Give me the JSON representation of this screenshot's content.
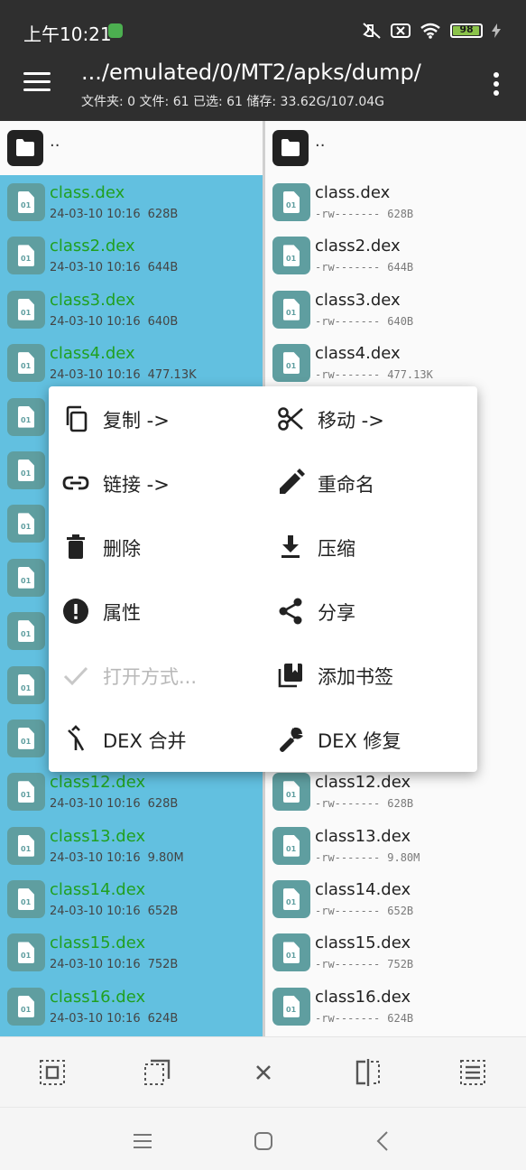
{
  "status_bar": {
    "time": "上午10:21",
    "battery": "98",
    "battery_level": 0.98
  },
  "header": {
    "path": ".../emulated/0/MT2/apks/dump/",
    "info": "文件夹: 0  文件: 61  已选: 61  储存: 33.62G/107.04G"
  },
  "parent_label": "..",
  "left_files": [
    {
      "name": "class.dex",
      "date": "24-03-10 10:16",
      "size": "628B"
    },
    {
      "name": "class2.dex",
      "date": "24-03-10 10:16",
      "size": "644B"
    },
    {
      "name": "class3.dex",
      "date": "24-03-10 10:16",
      "size": "640B"
    },
    {
      "name": "class4.dex",
      "date": "24-03-10 10:16",
      "size": "477.13K"
    },
    {
      "name": "",
      "date": "",
      "size": ""
    },
    {
      "name": "",
      "date": "",
      "size": ""
    },
    {
      "name": "",
      "date": "",
      "size": ""
    },
    {
      "name": "",
      "date": "",
      "size": ""
    },
    {
      "name": "",
      "date": "",
      "size": ""
    },
    {
      "name": "",
      "date": "",
      "size": ""
    },
    {
      "name": "",
      "date": "",
      "size": ""
    },
    {
      "name": "class12.dex",
      "date": "24-03-10 10:16",
      "size": "628B"
    },
    {
      "name": "class13.dex",
      "date": "24-03-10 10:16",
      "size": "9.80M"
    },
    {
      "name": "class14.dex",
      "date": "24-03-10 10:16",
      "size": "652B"
    },
    {
      "name": "class15.dex",
      "date": "24-03-10 10:16",
      "size": "752B"
    },
    {
      "name": "class16.dex",
      "date": "24-03-10 10:16",
      "size": "624B"
    }
  ],
  "right_files": [
    {
      "name": "class.dex",
      "perm": "-rw-------",
      "size": "628B"
    },
    {
      "name": "class2.dex",
      "perm": "-rw-------",
      "size": "644B"
    },
    {
      "name": "class3.dex",
      "perm": "-rw-------",
      "size": "640B"
    },
    {
      "name": "class4.dex",
      "perm": "-rw-------",
      "size": "477.13K"
    },
    {
      "name": "",
      "perm": "",
      "size": ""
    },
    {
      "name": "",
      "perm": "",
      "size": ""
    },
    {
      "name": "",
      "perm": "",
      "size": ""
    },
    {
      "name": "",
      "perm": "",
      "size": ""
    },
    {
      "name": "",
      "perm": "",
      "size": ""
    },
    {
      "name": "",
      "perm": "",
      "size": ""
    },
    {
      "name": "",
      "perm": "",
      "size": ""
    },
    {
      "name": "class12.dex",
      "perm": "-rw-------",
      "size": "628B"
    },
    {
      "name": "class13.dex",
      "perm": "-rw-------",
      "size": "9.80M"
    },
    {
      "name": "class14.dex",
      "perm": "-rw-------",
      "size": "652B"
    },
    {
      "name": "class15.dex",
      "perm": "-rw-------",
      "size": "752B"
    },
    {
      "name": "class16.dex",
      "perm": "-rw-------",
      "size": "624B"
    }
  ],
  "context_menu": {
    "copy": "复制 ->",
    "move": "移动 ->",
    "link": "链接 ->",
    "rename": "重命名",
    "delete": "删除",
    "compress": "压缩",
    "properties": "属性",
    "share": "分享",
    "open_with": "打开方式...",
    "add_bookmark": "添加书签",
    "dex_merge": "DEX 合并",
    "dex_repair": "DEX 修复"
  },
  "colors": {
    "header_bg": "#2f2f2f",
    "selection_bg": "#62c0e0",
    "selected_name": "#20a020",
    "file_icon": "#5f9ea0"
  }
}
